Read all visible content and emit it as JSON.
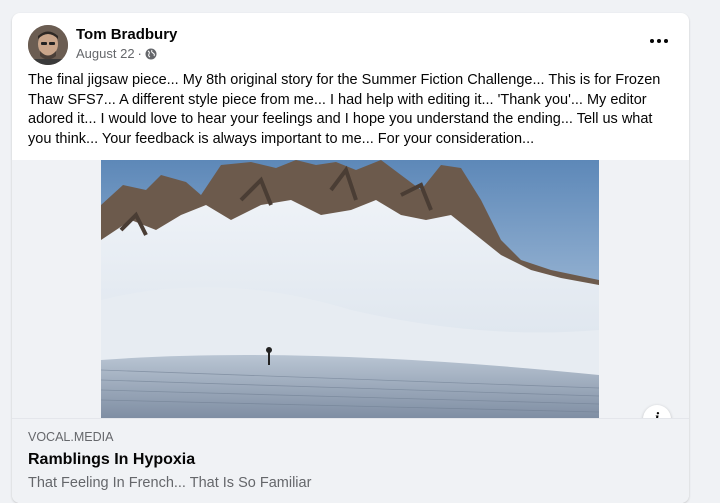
{
  "post": {
    "author": "Tom Bradbury",
    "date": "August 22",
    "separator": "·",
    "privacy_icon": "globe-icon",
    "more_icon": "more-options-icon",
    "text": "The final jigsaw piece... My 8th original story for the Summer Fiction Challenge... This is for Frozen Thaw SFS7... A different style piece from me... I had help with editing it... 'Thank you'... My editor adored it... I would love to hear your feelings and I hope you understand the ending... Tell us what you think... Your feedback is always important to me... For your consideration..."
  },
  "link_preview": {
    "image_icon": "snowy-mountain-photo",
    "info_icon": "info-icon",
    "domain": "VOCAL.MEDIA",
    "title": "Ramblings In Hypoxia",
    "subtitle": "That Feeling In French... That Is So Familiar"
  }
}
